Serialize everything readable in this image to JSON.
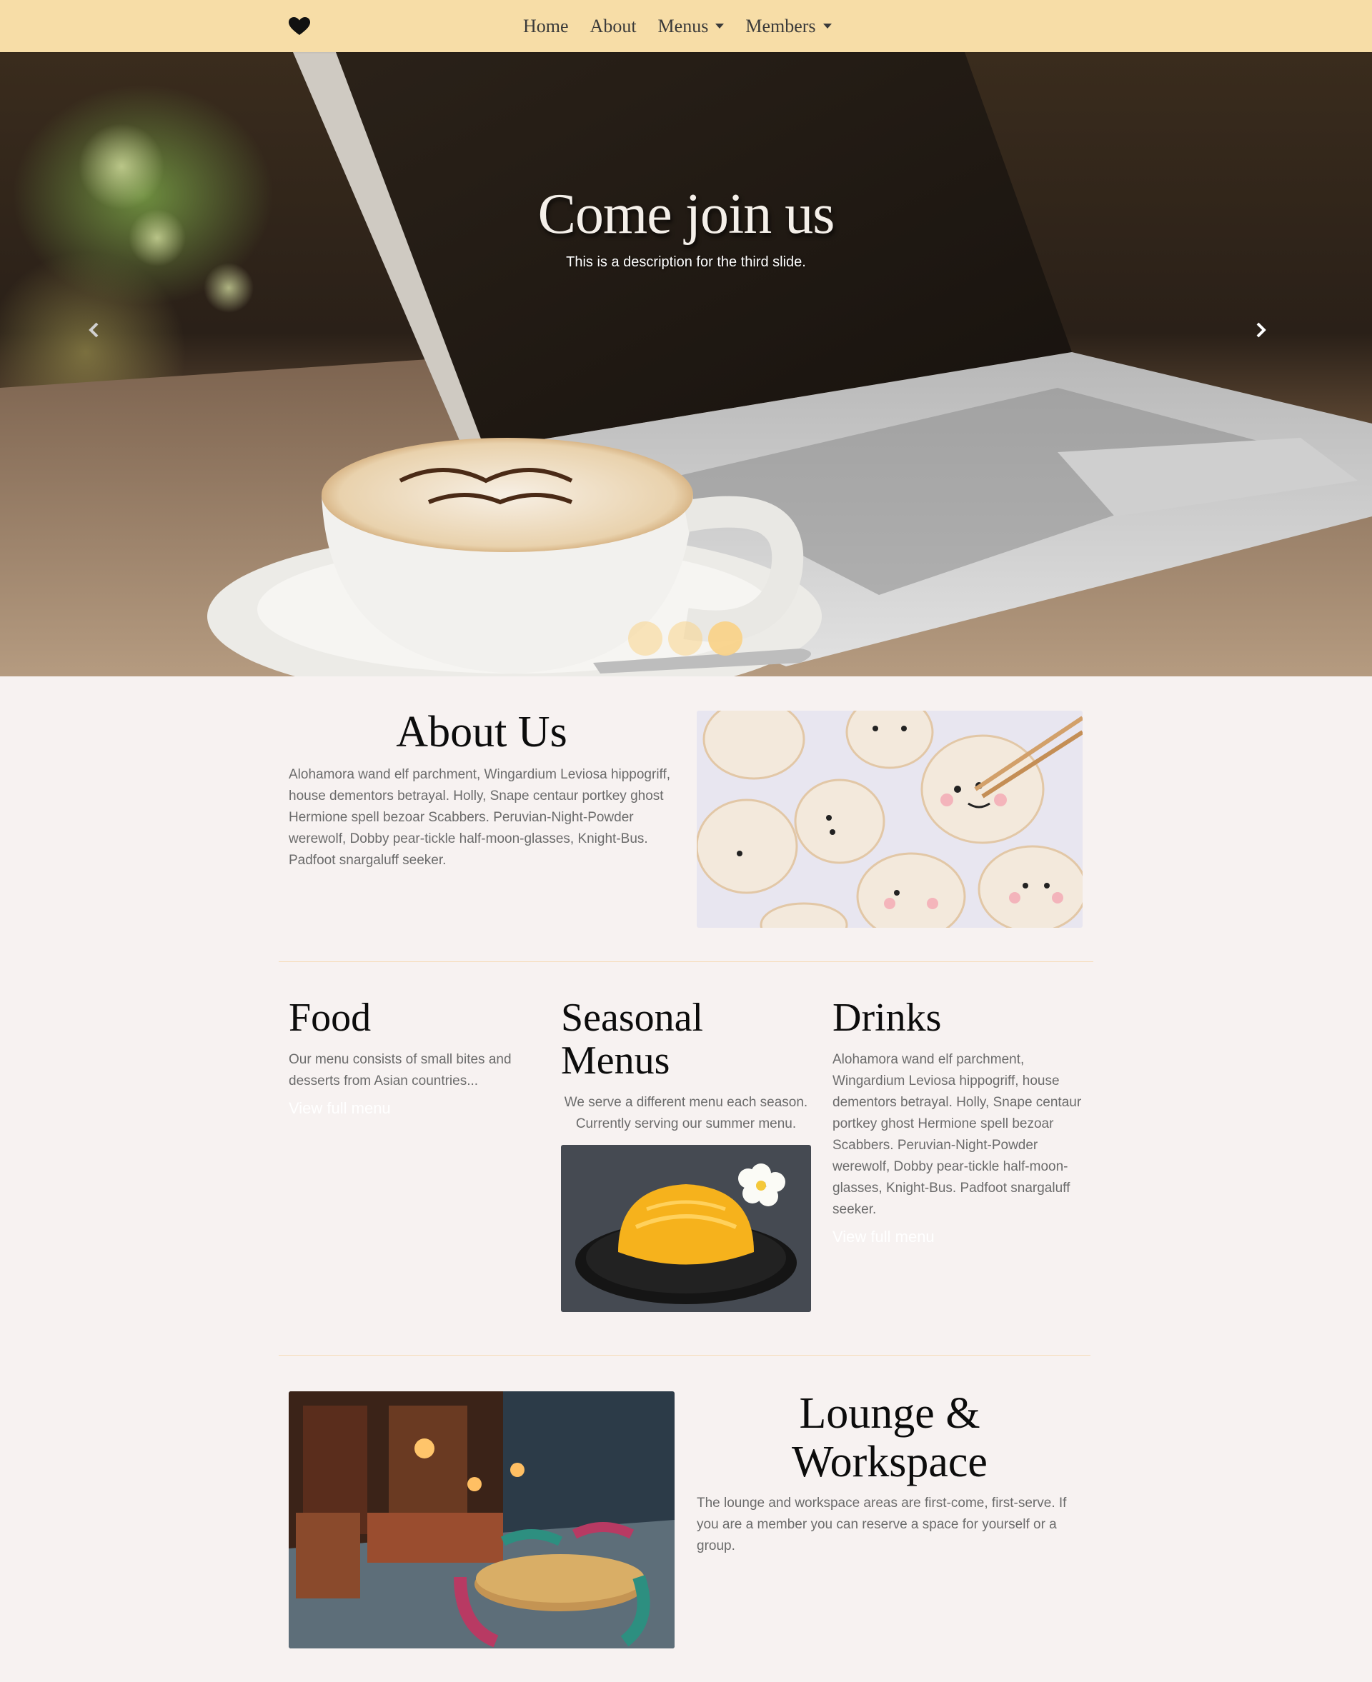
{
  "nav": {
    "brand_icon": "heart-icon",
    "links": [
      {
        "label": "Home",
        "dropdown": false
      },
      {
        "label": "About",
        "dropdown": false
      },
      {
        "label": "Menus",
        "dropdown": true
      },
      {
        "label": "Members",
        "dropdown": true
      }
    ],
    "bg_color": "#f7dda7"
  },
  "hero": {
    "title": "Come join us",
    "description": "This is a description for the third slide.",
    "prev_icon": "chevron-left-icon",
    "next_icon": "chevron-right-icon",
    "indicators": [
      false,
      false,
      true
    ],
    "indicator_color": "#f9d38a"
  },
  "about": {
    "title": "About Us",
    "text": "Alohamora wand elf parchment, Wingardium Leviosa hippogriff, house dementors betrayal. Holly, Snape centaur portkey ghost Hermione spell bezoar Scabbers. Peruvian-Night-Powder werewolf, Dobby pear-tickle half-moon-glasses, Knight-Bus. Padfoot snargaluff seeker."
  },
  "food": {
    "title": "Food",
    "text": "Our menu consists of small bites and desserts from Asian countries...",
    "link": "View full menu"
  },
  "seasonal": {
    "title": "Seasonal Menus",
    "text": "We serve a different menu each season. Currently serving our summer menu."
  },
  "drinks": {
    "title": "Drinks",
    "text": "Alohamora wand elf parchment, Wingardium Leviosa hippogriff, house dementors betrayal. Holly, Snape centaur portkey ghost Hermione spell bezoar Scabbers. Peruvian-Night-Powder werewolf, Dobby pear-tickle half-moon-glasses, Knight-Bus. Padfoot snargaluff seeker.",
    "link": "View full menu"
  },
  "lounge": {
    "title": "Lounge & Workspace",
    "text": "The lounge and workspace areas are first-come, first-serve. If you are a member you can reserve a space for yourself or a group."
  },
  "colors": {
    "page_bg": "#f7f2f1",
    "divider": "#f6dcb9",
    "text_muted": "#6b6b6b"
  }
}
